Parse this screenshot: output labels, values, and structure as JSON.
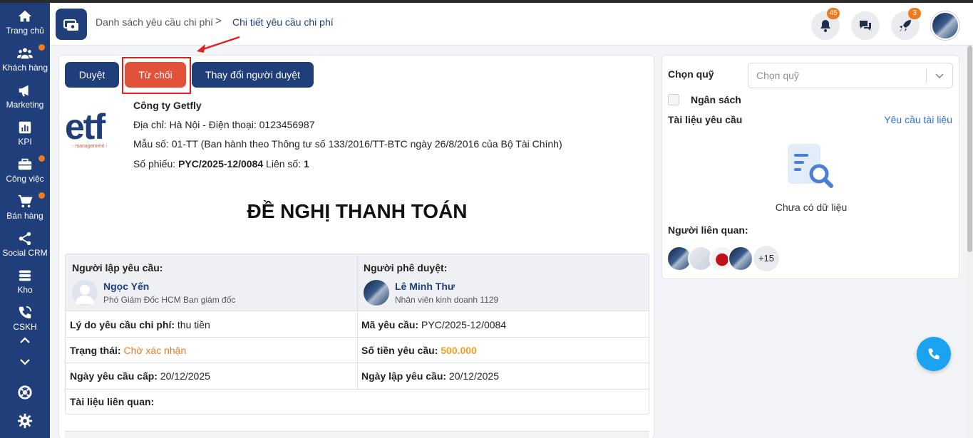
{
  "sidebar": {
    "items": [
      {
        "label": "Trang chủ",
        "icon": "home-icon",
        "dot": false
      },
      {
        "label": "Khách hàng",
        "icon": "users-icon",
        "dot": true
      },
      {
        "label": "Marketing",
        "icon": "megaphone-icon",
        "dot": false
      },
      {
        "label": "KPI",
        "icon": "chart-icon",
        "dot": false
      },
      {
        "label": "Công việc",
        "icon": "briefcase-icon",
        "dot": true
      },
      {
        "label": "Bán hàng",
        "icon": "cart-icon",
        "dot": true
      },
      {
        "label": "Social CRM",
        "icon": "share-icon",
        "dot": false
      },
      {
        "label": "Kho",
        "icon": "warehouse-icon",
        "dot": false
      },
      {
        "label": "CSKH",
        "icon": "phone-icon",
        "dot": false
      }
    ]
  },
  "header": {
    "breadcrumb_parent": "Danh sách yêu cầu chi phí",
    "breadcrumb_sep": ">",
    "breadcrumb_current": "Chi tiết yêu cầu chi phí",
    "notifications_count": "45",
    "rocket_count": "3"
  },
  "actions": {
    "approve": "Duyệt",
    "reject": "Từ chối",
    "change_approver": "Thay đổi người duyệt"
  },
  "company": {
    "logo_text": "etf",
    "logo_sub": "- management -",
    "name": "Công ty Getfly",
    "address": "Địa chỉ: Hà Nội - Điện thoại: 0123456987",
    "form": "Mẫu số: 01-TT (Ban hành theo Thông tư số 133/2016/TT-BTC ngày 26/8/2016 của Bộ Tài Chính)",
    "voucher_label": "Số phiếu: ",
    "voucher_no": "PYC/2025-12/0084",
    "copy_label": " Liên số: ",
    "copy_no": "1"
  },
  "document": {
    "title": "ĐỀ NGHỊ THANH TOÁN",
    "requester_label": "Người lập yêu cầu:",
    "requester_name": "Ngọc Yến",
    "requester_role": "Phó Giám Đốc HCM Ban giám đốc",
    "approver_label": "Người phê duyệt:",
    "approver_name": "Lê Minh Thư",
    "approver_role": "Nhân viên kinh doanh 1129",
    "reason_label": "Lý do yêu cầu chi phí:",
    "reason_value": " thu tiền",
    "code_label": "Mã yêu cầu:",
    "code_value": " PYC/2025-12/0084",
    "status_label": "Trạng thái:",
    "status_value": " Chờ xác nhận",
    "amount_label": "Số tiền yêu cầu:",
    "amount_value": " 500.000",
    "grant_date_label": "Ngày yêu cầu cấp:",
    "grant_date_value": " 20/12/2025",
    "create_date_label": "Ngày lập yêu cầu:",
    "create_date_value": " 20/12/2025",
    "docs_label": "Tài liệu liên quan:"
  },
  "panel": {
    "fund_label": "Chọn quỹ",
    "fund_placeholder": "Chọn quỹ",
    "budget_label": "Ngân sách",
    "docs_label": "Tài liệu yêu cầu",
    "docs_link": "Yêu cầu tài liệu",
    "empty_text": "Chưa có dữ liệu",
    "related_label": "Người liên quan:",
    "related_more": "+15"
  },
  "colors": {
    "primary": "#1f3e7a",
    "reject": "#e2523a",
    "accent_orange": "#f07b1f",
    "link_blue": "#2d6fd8",
    "call_blue": "#1aa3f0"
  }
}
